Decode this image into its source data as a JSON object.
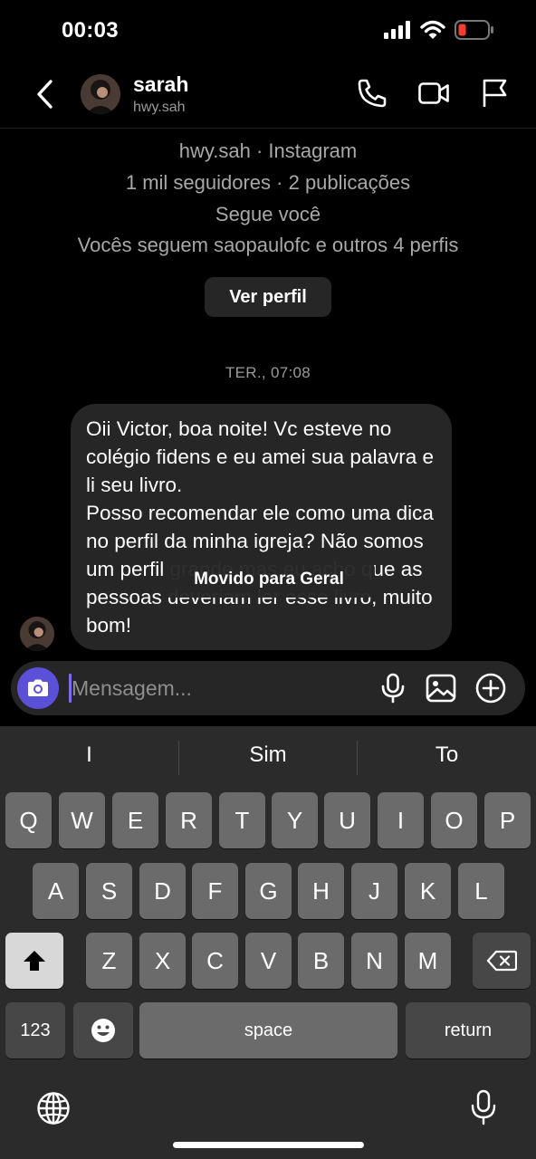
{
  "status_bar": {
    "time": "00:03"
  },
  "header": {
    "name": "sarah",
    "handle": "hwy.sah"
  },
  "profile": {
    "line1": "hwy.sah · Instagram",
    "line2": "1 mil seguidores · 2 publicações",
    "line3": "Segue você",
    "line4": "Vocês seguem saopaulofc e outros 4 perfis",
    "view_button": "Ver perfil"
  },
  "thread": {
    "timestamp": "TER., 07:08",
    "message_p1": "Oii Victor, boa noite! Vc esteve no colégio fidens e eu amei sua palavra e li seu livro.",
    "message_p2": "Posso recomendar ele como uma dica no perfil da minha igreja? Não somos um perfil grande mas eu acho que as pessoas deveriam ler esse livro, muito bom!",
    "toast": "Movido para Geral"
  },
  "composer": {
    "placeholder": "Mensagem..."
  },
  "keyboard": {
    "suggestions": [
      "I",
      "Sim",
      "To"
    ],
    "row1": [
      "Q",
      "W",
      "E",
      "R",
      "T",
      "Y",
      "U",
      "I",
      "O",
      "P"
    ],
    "row2": [
      "A",
      "S",
      "D",
      "F",
      "G",
      "H",
      "J",
      "K",
      "L"
    ],
    "row3": [
      "Z",
      "X",
      "C",
      "V",
      "B",
      "N",
      "M"
    ],
    "numbers_label": "123",
    "space_label": "space",
    "return_label": "return"
  },
  "colors": {
    "background": "#000000",
    "bubble": "#262626",
    "accent_camera": "#5b51d8",
    "battery_low": "#ff3b30",
    "keyboard_bg": "#2b2b2b",
    "key": "#6b6b6b"
  },
  "icons": {
    "status": [
      "cellular-signal-icon",
      "wifi-icon",
      "battery-low-icon"
    ],
    "header": [
      "back-chevron-icon",
      "phone-icon",
      "video-call-icon",
      "flag-icon"
    ],
    "composer": [
      "camera-icon",
      "microphone-icon",
      "gallery-icon",
      "plus-circle-icon"
    ],
    "keyboard": [
      "shift-icon",
      "backspace-icon",
      "emoji-icon",
      "globe-icon",
      "dictation-icon"
    ]
  }
}
